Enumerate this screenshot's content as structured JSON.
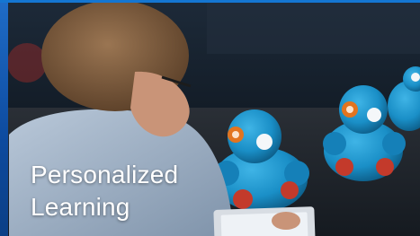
{
  "caption": {
    "line1": "Personalized",
    "line2": "Learning"
  },
  "colors": {
    "frame_blue": "#1476d2",
    "robot_blue": "#1a8fc7",
    "robot_eye_orange": "#e2741f",
    "robot_wheel_red": "#c33a2b",
    "text": "#ffffff"
  }
}
